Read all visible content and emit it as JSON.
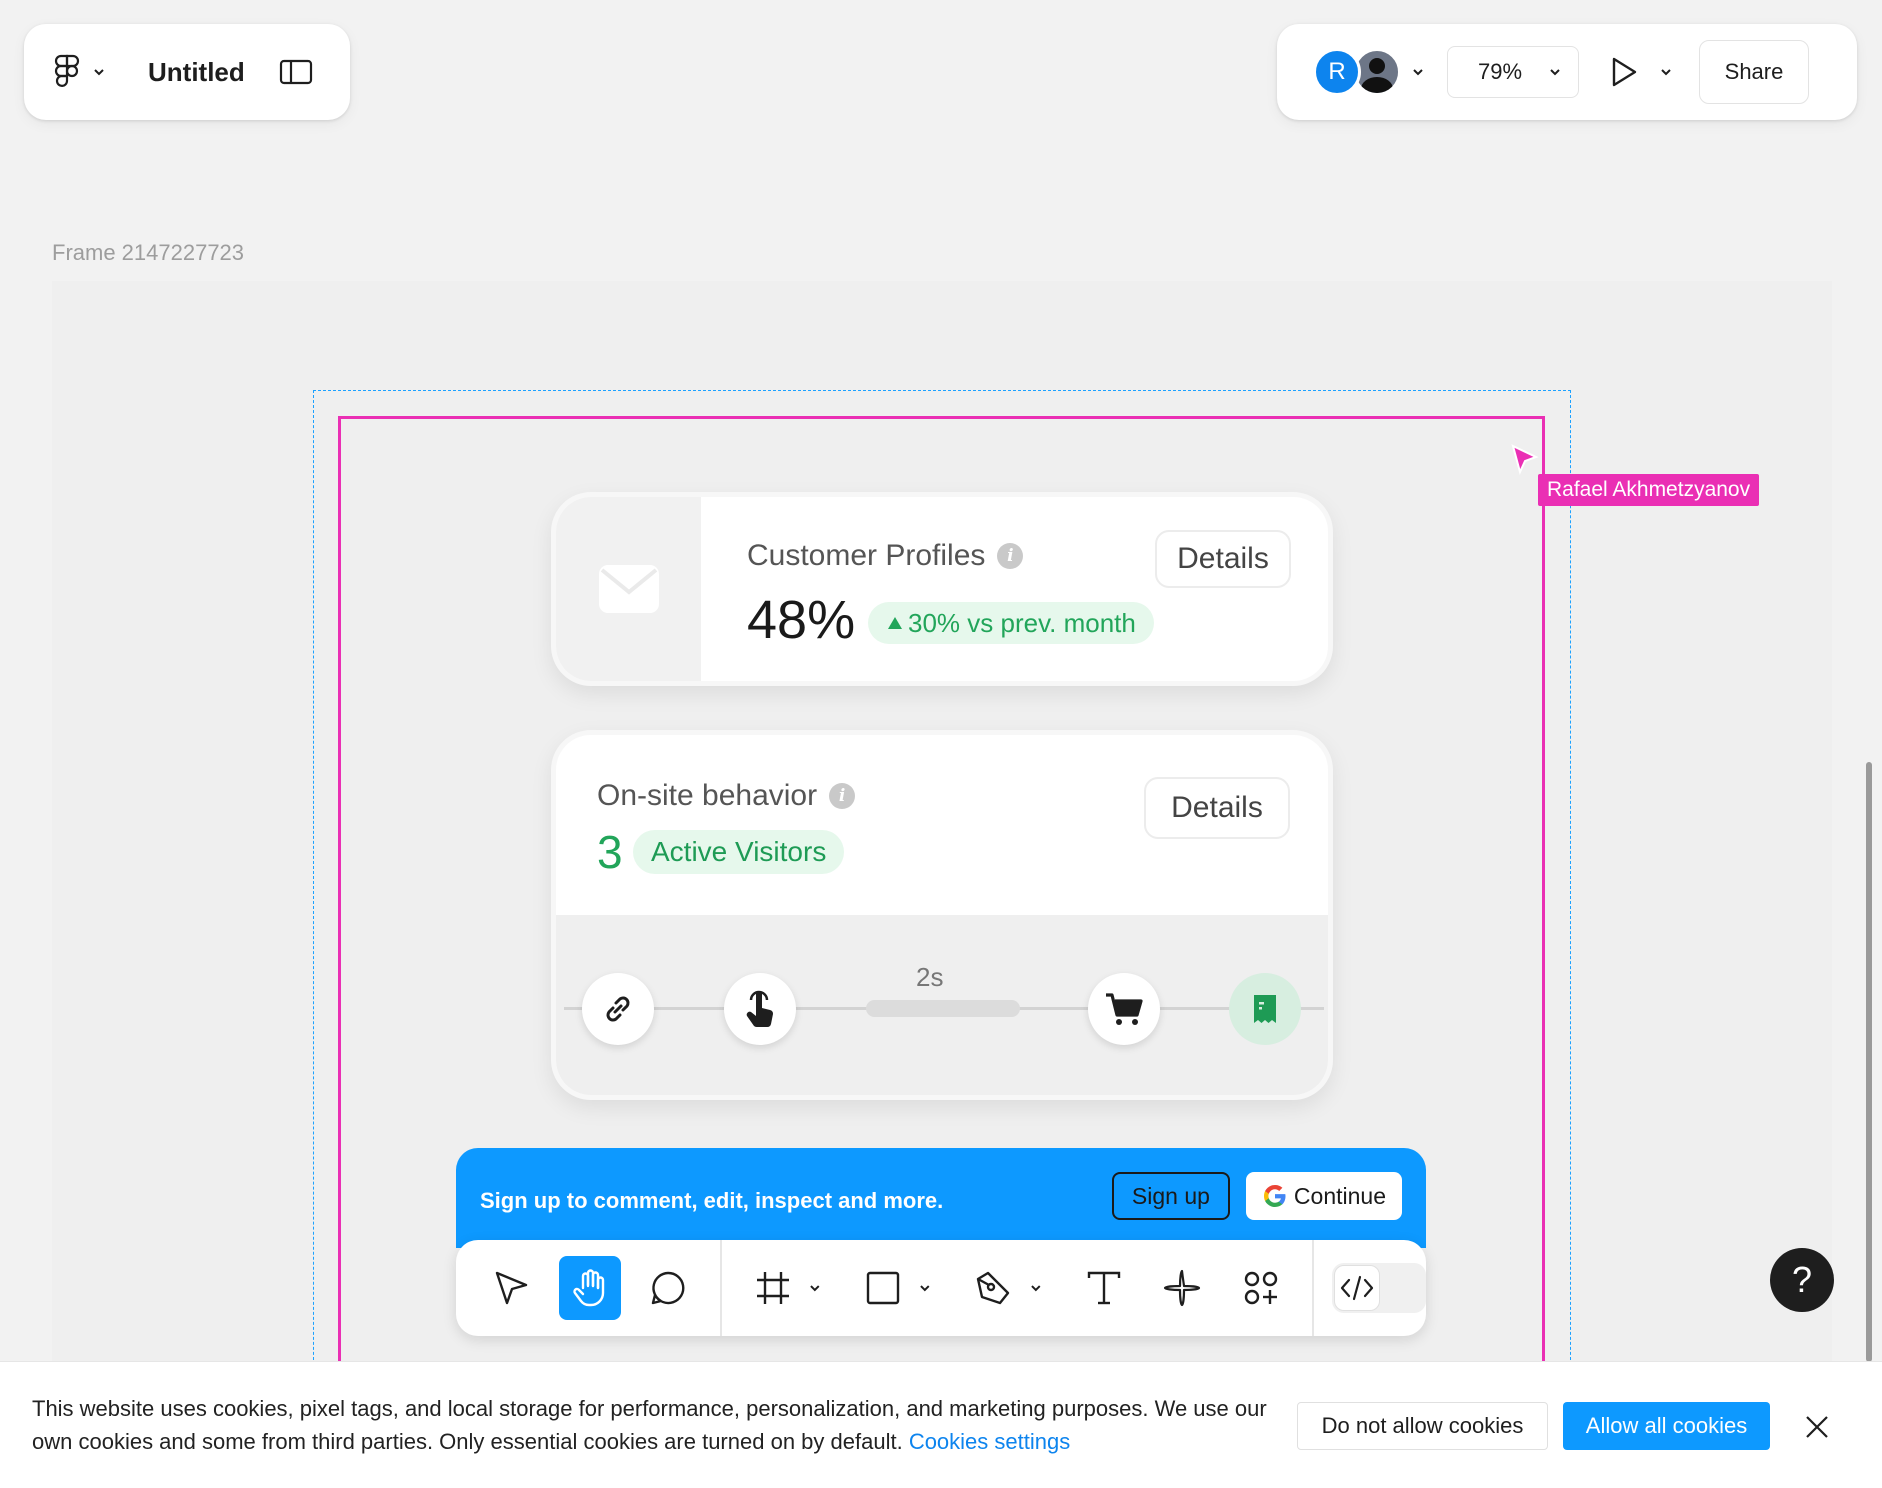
{
  "header": {
    "title": "Untitled",
    "avatar_initial": "R",
    "zoom": "79%",
    "share_label": "Share"
  },
  "canvas": {
    "frame_label": "Frame 2147227723",
    "cursor_user": "Rafael Akhmetzyanov"
  },
  "card1": {
    "title": "Customer Profiles",
    "value": "48%",
    "delta": "30% vs prev. month",
    "details_label": "Details",
    "icon": "mail-icon"
  },
  "card2": {
    "title": "On-site behavior",
    "value": "3",
    "badge": "Active Visitors",
    "details_label": "Details",
    "step_time": "2s",
    "steps": [
      "link-icon",
      "tap-icon",
      "cart-icon",
      "receipt-icon"
    ]
  },
  "signup": {
    "text": "Sign up to comment, edit, inspect and more.",
    "signup_label": "Sign up",
    "continue_label": "Continue"
  },
  "toolbar": {
    "tools": [
      "move-tool",
      "hand-tool",
      "comment-tool",
      "frame-tool",
      "shape-tool",
      "pen-tool",
      "text-tool",
      "actions-tool",
      "assets-tool",
      "dev-mode-toggle"
    ]
  },
  "help": {
    "label": "?"
  },
  "cookies": {
    "text": "This website uses cookies, pixel tags, and local storage for performance, personalization, and marketing purposes. We use our own cookies and some from third parties. Only essential cookies are turned on by default.",
    "settings_link": "Cookies settings",
    "deny_label": "Do not allow cookies",
    "allow_label": "Allow all cookies"
  },
  "colors": {
    "accent": "#0d99ff",
    "selection": "#ea2fb4",
    "positive": "#22a55a"
  }
}
